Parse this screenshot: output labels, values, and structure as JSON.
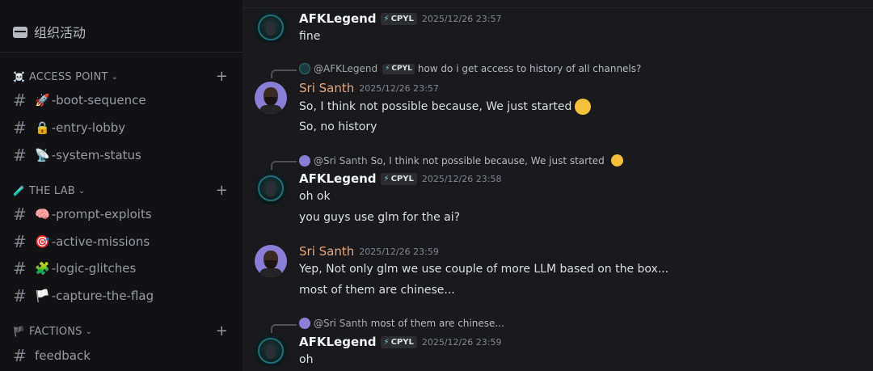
{
  "sidebar": {
    "event_label": "组织活动",
    "categories": [
      {
        "emoji": "☠️",
        "name": "ACCESS POINT",
        "channels": [
          {
            "emoji": "🚀",
            "name": "-boot-sequence"
          },
          {
            "emoji": "🔒",
            "name": "-entry-lobby"
          },
          {
            "emoji": "📡",
            "name": "-system-status"
          }
        ]
      },
      {
        "emoji": "🧪",
        "name": "THE LAB",
        "channels": [
          {
            "emoji": "🧠",
            "name": "-prompt-exploits"
          },
          {
            "emoji": "🎯",
            "name": "-active-missions"
          },
          {
            "emoji": "🧩",
            "name": "-logic-glitches"
          },
          {
            "emoji": "🏳️",
            "name": "-capture-the-flag"
          }
        ]
      },
      {
        "emoji": "🏴",
        "name": "FACTIONS",
        "channels": [
          {
            "emoji": "",
            "name": "feedback"
          }
        ]
      }
    ],
    "hash_symbol": "#",
    "chevron": "⌄",
    "plus": "+"
  },
  "messages": [
    {
      "author": "AFKLegend",
      "tag": "CPYL",
      "timestamp": "2025/12/26 23:57",
      "lines": [
        "fine"
      ]
    },
    {
      "reply": {
        "author": "@AFKLegend",
        "tag": "CPYL",
        "text": "how do i get access to history of all channels?"
      },
      "author": "Sri Santh",
      "timestamp": "2025/12/26 23:57",
      "lines": [
        "So, I think not possible because, We just started",
        "So, no history"
      ]
    },
    {
      "reply": {
        "author": "@Sri Santh",
        "text": "So, I think not possible because, We just started"
      },
      "author": "AFKLegend",
      "tag": "CPYL",
      "timestamp": "2025/12/26 23:58",
      "lines": [
        "oh ok",
        "you guys use glm for the ai?"
      ]
    },
    {
      "author": "Sri Santh",
      "timestamp": "2025/12/26 23:59",
      "lines": [
        "Yep, Not only glm we use couple of more LLM based on the box...",
        "most of them are chinese..."
      ]
    },
    {
      "reply": {
        "author": "@Sri Santh",
        "text": "most of them are chinese..."
      },
      "author": "AFKLegend",
      "tag": "CPYL",
      "timestamp": "2025/12/26 23:59",
      "lines": [
        "oh"
      ]
    }
  ],
  "icons": {
    "bolt": "⚡",
    "upside_down": "🙃"
  },
  "colors": {
    "sidebar_bg": "#121214",
    "main_bg": "#1a1a1e",
    "sri_name": "#e8a87c",
    "tag_bolt": "#7fd4e4"
  }
}
